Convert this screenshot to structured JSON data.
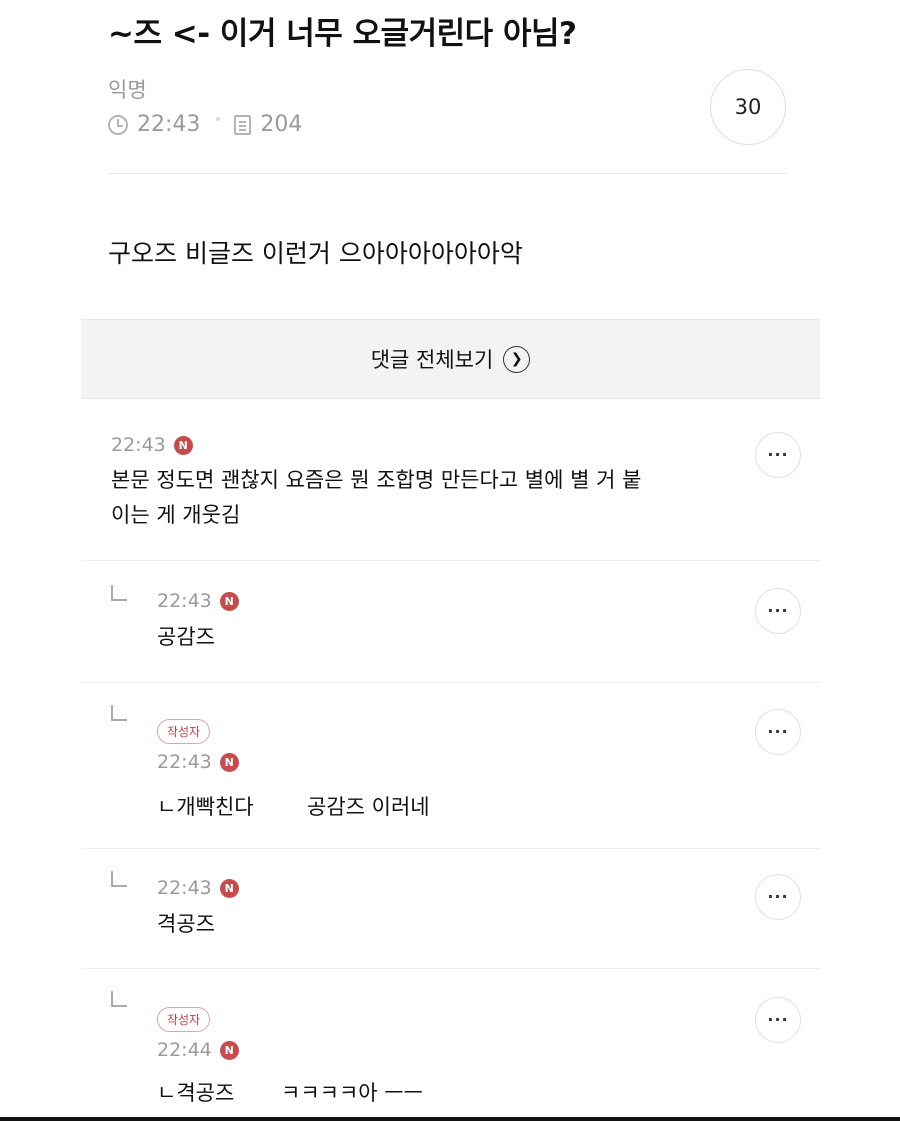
{
  "post": {
    "title": "~즈 <- 이거 너무 오글거린다 아님?",
    "author": "익명",
    "time": "22:43",
    "views": "204",
    "comment_count": "30",
    "body": "구오즈 비글즈 이런거 으아아아아아아악"
  },
  "view_all_label": "댓글 전체보기",
  "new_badge_label": "N",
  "author_badge_label": "작성자",
  "comments": [
    {
      "time": "22:43",
      "line1": "본문 정도면 괜찮지 요즘은 뭔 조합명 만든다고 별에 별 거 붙",
      "line2": "이는 게 개웃김"
    },
    {
      "time": "22:43",
      "text": "공감즈"
    },
    {
      "time": "22:43",
      "text": "ㄴ개빡친다        공감즈 이러네"
    },
    {
      "time": "22:43",
      "text": "격공즈"
    },
    {
      "time": "22:44",
      "text": "ㄴ격공즈       ㅋㅋㅋㅋ아 ㅡㅡ"
    }
  ],
  "colors": {
    "badge_red": "#c74a4d",
    "muted_gray": "#9a9a9a",
    "button_bg": "#f3f3f3"
  },
  "icons": [
    "clock-icon",
    "views-icon",
    "chevron-right-icon",
    "more-icon",
    "reply-arrow-icon"
  ]
}
